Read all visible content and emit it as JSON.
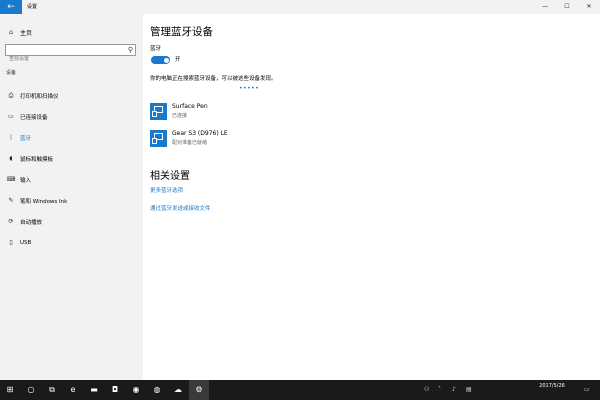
{
  "window": {
    "title": "设置",
    "back_glyph": "←",
    "minimize_glyph": "—",
    "maximize_glyph": "☐",
    "close_glyph": "✕"
  },
  "sidebar": {
    "home_label": "主页",
    "search_placeholder": "查找设置",
    "section_label": "设备",
    "items": [
      {
        "label": "打印机和扫描仪",
        "icon": "printer-icon",
        "glyph": "⎙",
        "active": false
      },
      {
        "label": "已连接设备",
        "icon": "connected-devices-icon",
        "glyph": "▭",
        "active": false
      },
      {
        "label": "蓝牙",
        "icon": "bluetooth-icon",
        "glyph": "ᛒ",
        "active": true
      },
      {
        "label": "鼠标和触摸板",
        "icon": "mouse-icon",
        "glyph": "◖",
        "active": false
      },
      {
        "label": "输入",
        "icon": "keyboard-icon",
        "glyph": "⌨",
        "active": false
      },
      {
        "label": "笔和 Windows Ink",
        "icon": "pen-icon",
        "glyph": "✎",
        "active": false
      },
      {
        "label": "自动播放",
        "icon": "autoplay-icon",
        "glyph": "⟳",
        "active": false
      },
      {
        "label": "USB",
        "icon": "usb-icon",
        "glyph": "▯",
        "active": false
      }
    ]
  },
  "main": {
    "title": "管理蓝牙设备",
    "bluetooth_label": "蓝牙",
    "toggle_state": "开",
    "searching_text": "你的电脑正在搜索蓝牙设备，可以被这些设备发现。",
    "progress_dots": "•••••",
    "devices": [
      {
        "name": "Surface Pen",
        "status": "已连接"
      },
      {
        "name": "Gear S3 (D976) LE",
        "status": "配对准备已就绪"
      }
    ],
    "related_title": "相关设置",
    "links": [
      "更多蓝牙选项",
      "通过蓝牙发送或接收文件"
    ]
  },
  "taskbar": {
    "items": [
      {
        "name": "start-button",
        "glyph": "⊞",
        "active": false
      },
      {
        "name": "cortana-button",
        "glyph": "○",
        "active": false
      },
      {
        "name": "task-view-button",
        "glyph": "⧉",
        "active": false
      },
      {
        "name": "edge-app",
        "glyph": "e",
        "active": false
      },
      {
        "name": "file-explorer-app",
        "glyph": "▬",
        "active": false
      },
      {
        "name": "store-app",
        "glyph": "◘",
        "active": false
      },
      {
        "name": "browser-app",
        "glyph": "◉",
        "active": false
      },
      {
        "name": "wechat-app",
        "glyph": "◍",
        "active": false
      },
      {
        "name": "cloud-app",
        "glyph": "☁",
        "active": false
      },
      {
        "name": "settings-app",
        "glyph": "⚙",
        "active": true
      }
    ],
    "date": "2017/5/26"
  },
  "colors": {
    "accent": "#1979ca",
    "sidebar_bg": "#f2f2f2",
    "taskbar_bg": "#1a1a1a"
  }
}
